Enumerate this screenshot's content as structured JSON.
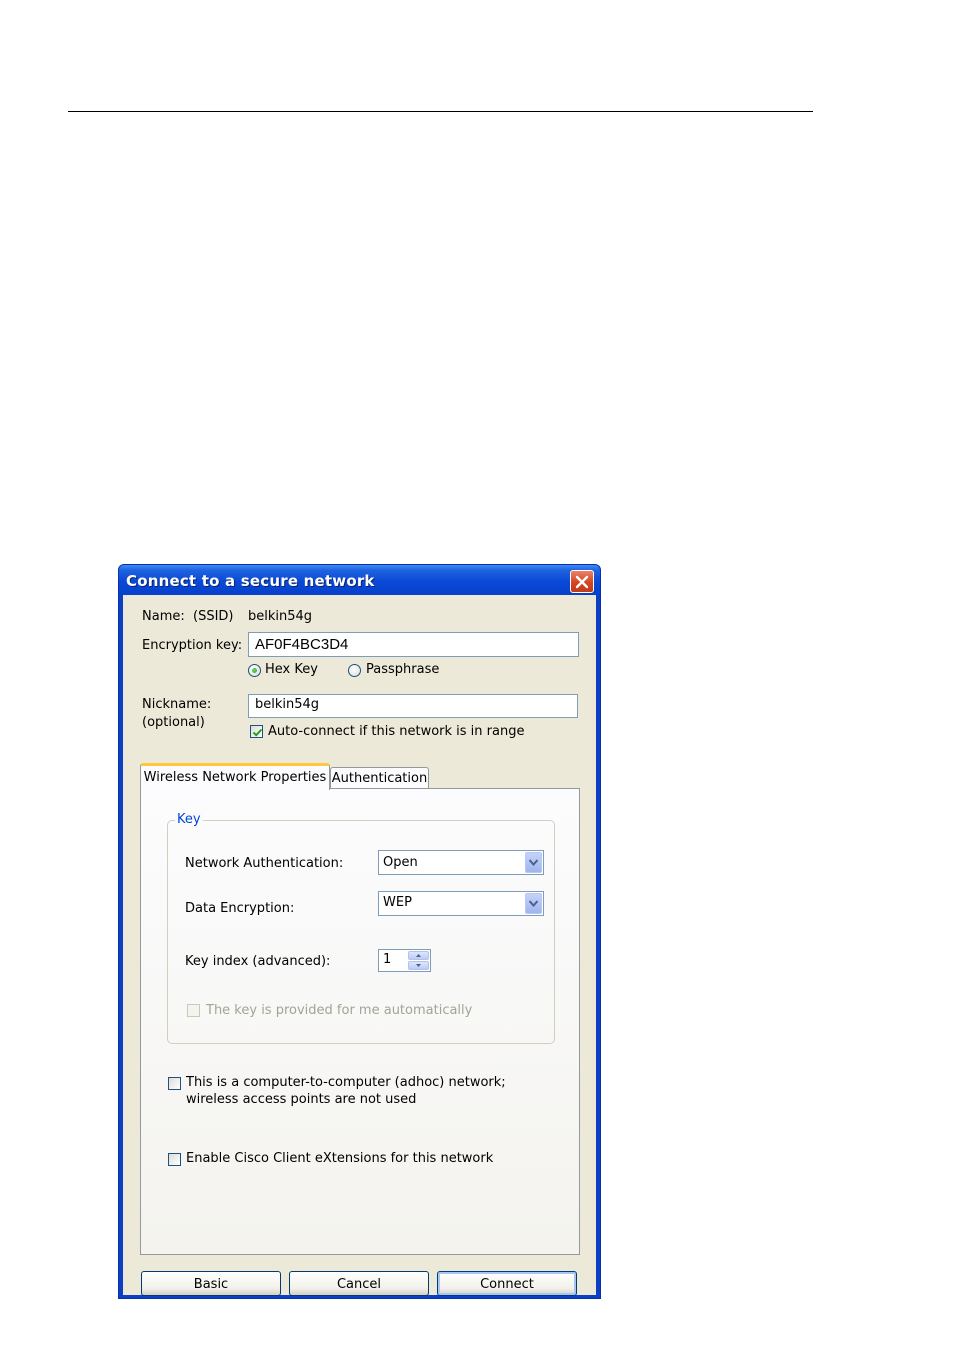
{
  "window": {
    "title": "Connect to a secure network"
  },
  "form": {
    "name_label": "Name:",
    "ssid_label": "(SSID)",
    "ssid_value": "belkin54g",
    "encryption_key_label": "Encryption key:",
    "encryption_key_value": "AF0F4BC3D4",
    "key_type_options": [
      "Hex Key",
      "Passphrase"
    ],
    "key_type_selected": "Hex Key",
    "nickname_label": "Nickname:",
    "nickname_optional": "(optional)",
    "nickname_value": "belkin54g",
    "auto_connect_label": "Auto-connect if this network is in range",
    "auto_connect_checked": true
  },
  "tabs": [
    {
      "label": "Wireless Network Properties",
      "active": true
    },
    {
      "label": "Authentication",
      "active": false
    }
  ],
  "key_group": {
    "title": "Key",
    "network_auth_label": "Network Authentication:",
    "network_auth_value": "Open",
    "data_encryption_label": "Data Encryption:",
    "data_encryption_value": "WEP",
    "key_index_label": "Key index (advanced):",
    "key_index_value": "1",
    "auto_key_label": "The key is provided for me automatically",
    "auto_key_checked": false,
    "auto_key_disabled": true
  },
  "options": {
    "adhoc_line1": "This is a computer-to-computer (adhoc) network;",
    "adhoc_line2": "wireless access points are not used",
    "adhoc_checked": false,
    "cisco_label": "Enable Cisco Client eXtensions for this network",
    "cisco_checked": false
  },
  "buttons": {
    "basic": "Basic",
    "cancel": "Cancel",
    "connect": "Connect"
  },
  "colors": {
    "title_bar": "#0a49d6",
    "dialog_face": "#ece9d8",
    "group_label": "#0046d5",
    "active_tab_accent": "#ffc73c",
    "close_button": "#d4451f"
  }
}
